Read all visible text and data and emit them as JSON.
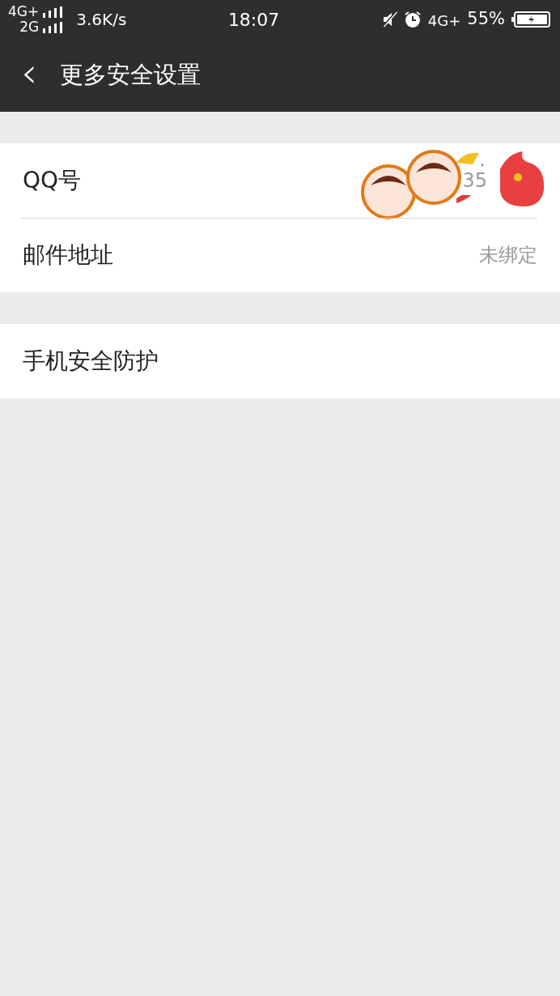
{
  "status_bar": {
    "networks": [
      "4G+",
      "2G"
    ],
    "speed": "3.6K/s",
    "time": "18:07",
    "network_right": "4G+",
    "battery": "55%"
  },
  "header": {
    "back": "‹",
    "title": "更多安全设置"
  },
  "groups": [
    {
      "rows": [
        {
          "label": "QQ号",
          "value": "35",
          "sticker": true
        },
        {
          "label": "邮件地址",
          "value": "未绑定",
          "sticker": false
        }
      ]
    },
    {
      "rows": [
        {
          "label": "手机安全防护",
          "sticker": false
        }
      ]
    }
  ]
}
